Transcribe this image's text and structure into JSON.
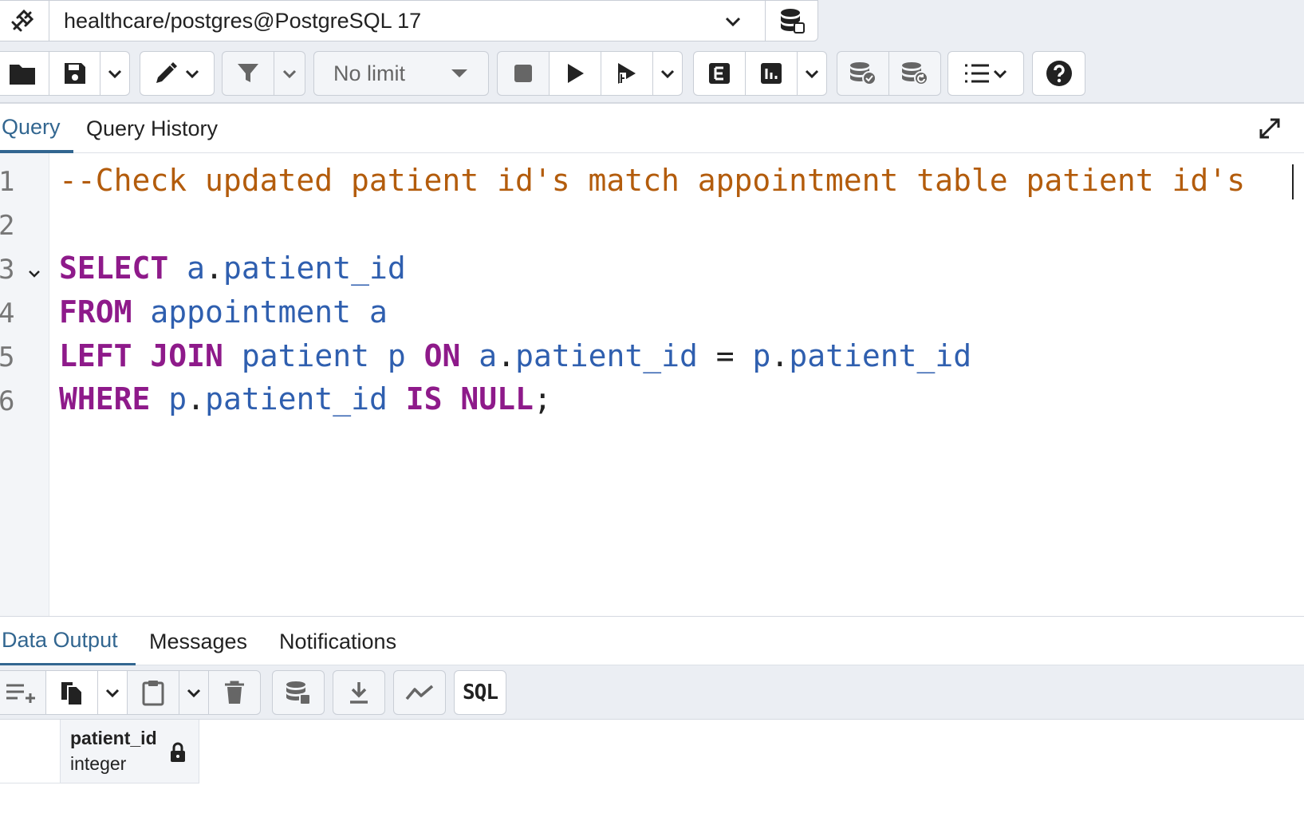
{
  "connection": {
    "label": "healthcare/postgres@PostgreSQL 17"
  },
  "toolbar": {
    "limit_label": "No limit"
  },
  "editor_tabs": [
    {
      "label": "Query",
      "active": true
    },
    {
      "label": "Query History",
      "active": false
    }
  ],
  "editor": {
    "line_numbers": [
      "1",
      "2",
      "3",
      "4",
      "5",
      "6"
    ],
    "lines": [
      "--Check updated patient id's match appointment table patient id's",
      "",
      "SELECT a.patient_id",
      "FROM appointment a",
      "LEFT JOIN patient p ON a.patient_id = p.patient_id",
      "WHERE p.patient_id IS NULL;"
    ]
  },
  "output_tabs": [
    {
      "label": "Data Output",
      "active": true
    },
    {
      "label": "Messages",
      "active": false
    },
    {
      "label": "Notifications",
      "active": false
    }
  ],
  "output_toolbar": {
    "sql_label": "SQL"
  },
  "grid": {
    "columns": [
      {
        "name": "patient_id",
        "type": "integer",
        "locked": true
      }
    ]
  },
  "colors": {
    "accent": "#326690",
    "keyword": "#8e1a8a",
    "identifier": "#2f5faf",
    "comment": "#b35c0c"
  }
}
